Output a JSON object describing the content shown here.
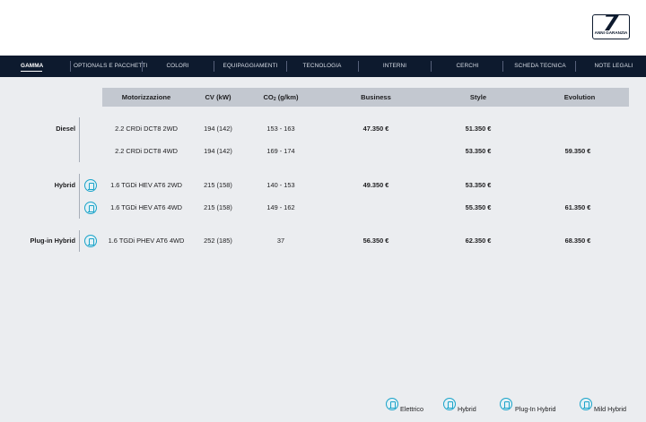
{
  "header": {
    "warranty_number": "7",
    "warranty_text": "ANNI GARANZIA"
  },
  "nav": {
    "items": [
      {
        "label": "GAMMA",
        "active": true
      },
      {
        "label": "OPTIONALS E PACCHETTI",
        "active": false
      },
      {
        "label": "COLORI",
        "active": false
      },
      {
        "label": "EQUIPAGGIAMENTI",
        "active": false
      },
      {
        "label": "TECNOLOGIA",
        "active": false
      },
      {
        "label": "INTERNI",
        "active": false
      },
      {
        "label": "CERCHI",
        "active": false
      },
      {
        "label": "SCHEDA TECNICA",
        "active": false
      },
      {
        "label": "NOTE LEGALI",
        "active": false
      }
    ]
  },
  "table": {
    "headers": {
      "motorizzazione": "Motorizzazione",
      "cv": "CV (kW)",
      "co2_prefix": "CO",
      "co2_sub": "2",
      "co2_suffix": " (g/km)",
      "business": "Business",
      "style": "Style",
      "evolution": "Evolution"
    },
    "groups": [
      {
        "label": "Diesel",
        "rows": [
          {
            "engine": "2.2 CRDi DCT8 2WD",
            "cv": "194 (142)",
            "co2": "153 - 163",
            "business": "47.350 €",
            "style": "51.350 €",
            "evolution": "",
            "icon": ""
          },
          {
            "engine": "2.2 CRDi DCT8 4WD",
            "cv": "194 (142)",
            "co2": "169 - 174",
            "business": "",
            "style": "53.350 €",
            "evolution": "59.350 €",
            "icon": ""
          }
        ]
      },
      {
        "label": "Hybrid",
        "rows": [
          {
            "engine": "1.6 TGDi HEV AT6 2WD",
            "cv": "215 (158)",
            "co2": "140 - 153",
            "business": "49.350 €",
            "style": "53.350 €",
            "evolution": "",
            "icon": "hybrid-icon"
          },
          {
            "engine": "1.6 TGDi HEV AT6 4WD",
            "cv": "215 (158)",
            "co2": "149 - 162",
            "business": "",
            "style": "55.350 €",
            "evolution": "61.350 €",
            "icon": "hybrid-icon"
          }
        ]
      },
      {
        "label": "Plug-in Hybrid",
        "rows": [
          {
            "engine": "1.6 TGDi PHEV AT6 4WD",
            "cv": "252 (185)",
            "co2": "37",
            "business": "56.350 €",
            "style": "62.350 €",
            "evolution": "68.350 €",
            "icon": "plug-in-hybrid-icon"
          }
        ]
      }
    ]
  },
  "legend": [
    {
      "label": "Elettrico",
      "icon": "electric-icon"
    },
    {
      "label": "Hybrid",
      "icon": "hybrid-icon"
    },
    {
      "label": "Plug-In Hybrid",
      "icon": "plug-in-hybrid-icon"
    },
    {
      "label": "Mild Hybrid",
      "icon": "mild-hybrid-icon"
    }
  ],
  "colors": {
    "nav_background": "#0d1a2e",
    "page_background": "#ebedf0",
    "table_header": "#c3c8d0",
    "icon_accent": "#1aa3c9"
  }
}
